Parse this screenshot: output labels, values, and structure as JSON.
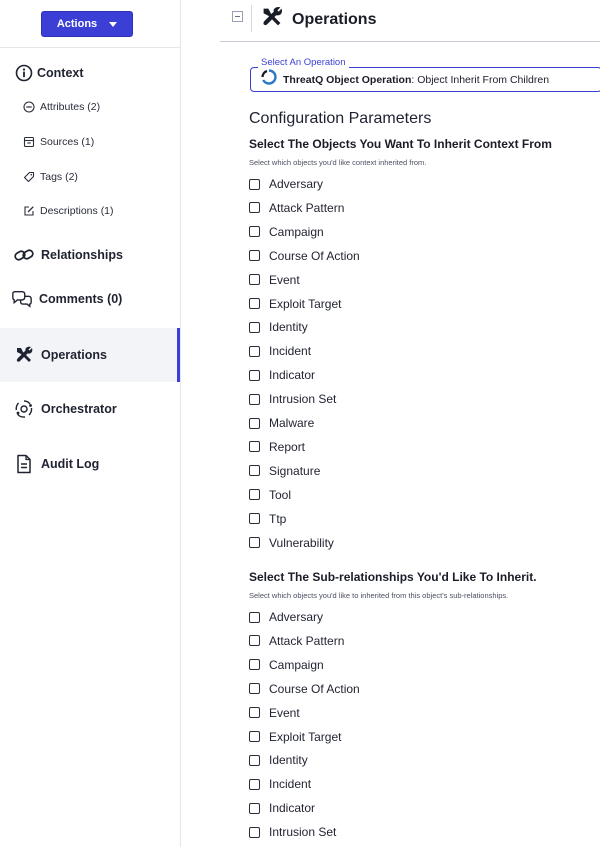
{
  "sidebar": {
    "actions_label": "Actions",
    "context_label": "Context",
    "sub_items": [
      {
        "label": "Attributes (2)",
        "icon": "minus-circle-icon"
      },
      {
        "label": "Sources (1)",
        "icon": "inbox-icon"
      },
      {
        "label": "Tags (2)",
        "icon": "tag-icon"
      },
      {
        "label": "Descriptions (1)",
        "icon": "edit-icon"
      }
    ],
    "items": [
      {
        "label": "Relationships",
        "icon": "link-icon"
      },
      {
        "label": "Comments (0)",
        "icon": "comments-icon"
      },
      {
        "label": "Operations",
        "icon": "tools-icon",
        "active": true
      },
      {
        "label": "Orchestrator",
        "icon": "orchestrator-icon"
      },
      {
        "label": "Audit Log",
        "icon": "document-icon"
      }
    ],
    "accent_color": "#3b3fd6"
  },
  "header": {
    "title": "Operations"
  },
  "operation_select": {
    "legend": "Select An Operation",
    "value_bold": "ThreatQ Object Operation",
    "value_rest": ": Object Inherit From Children"
  },
  "config": {
    "title": "Configuration Parameters",
    "groups": [
      {
        "title": "Select The Objects You Want To Inherit Context From",
        "description": "Select which objects you'd like context inherited from.",
        "options": [
          "Adversary",
          "Attack Pattern",
          "Campaign",
          "Course Of Action",
          "Event",
          "Exploit Target",
          "Identity",
          "Incident",
          "Indicator",
          "Intrusion Set",
          "Malware",
          "Report",
          "Signature",
          "Tool",
          "Ttp",
          "Vulnerability"
        ]
      },
      {
        "title": "Select The Sub-relationships You'd Like To Inherit.",
        "description": "Select which objects you'd like to inherited from this object's sub-relationships.",
        "options": [
          "Adversary",
          "Attack Pattern",
          "Campaign",
          "Course Of Action",
          "Event",
          "Exploit Target",
          "Identity",
          "Incident",
          "Indicator",
          "Intrusion Set"
        ]
      }
    ]
  }
}
